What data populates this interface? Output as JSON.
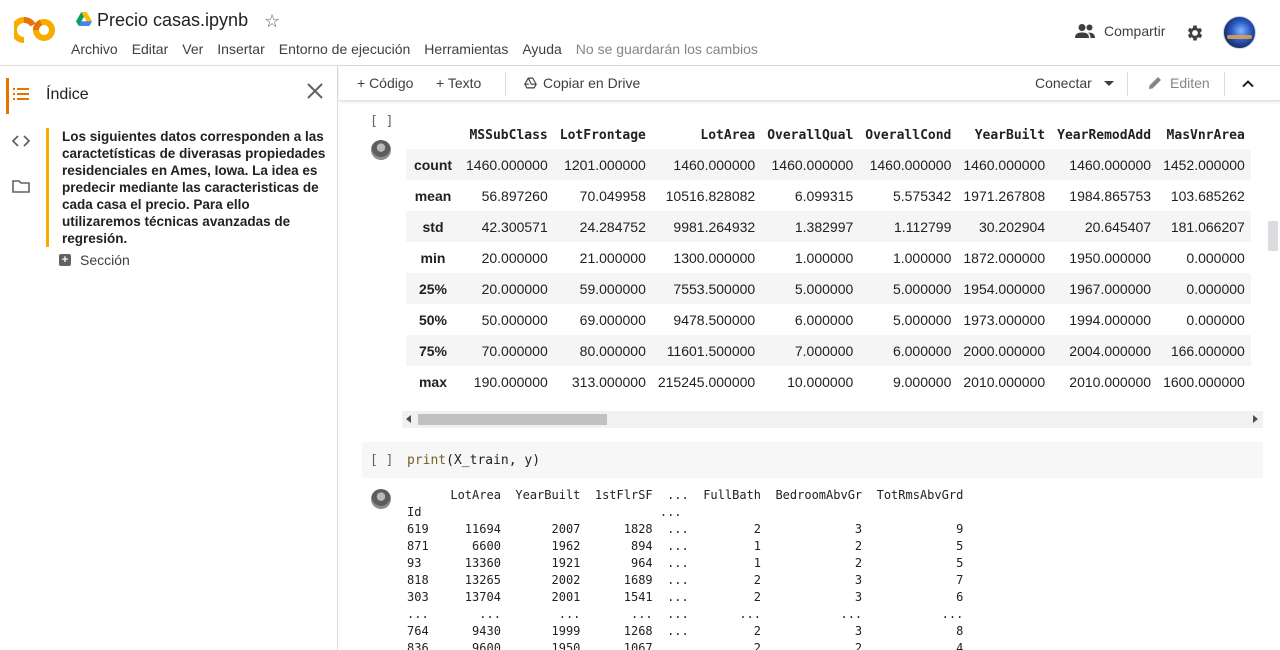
{
  "colors": {
    "accent": "#e37400",
    "logo_orange": "#f9ab00",
    "toc_border": "#f9ab00"
  },
  "header": {
    "title": "Precio casas.ipynb",
    "menu": [
      "Archivo",
      "Editar",
      "Ver",
      "Insertar",
      "Entorno de ejecución",
      "Herramientas",
      "Ayuda"
    ],
    "save_status": "No se guardarán los cambios",
    "share_label": "Compartir"
  },
  "sidebar": {
    "title": "Índice",
    "toc_entry": "Los siguientes datos corresponden a las caractetísticas de diverasas propiedades residenciales en Ames, Iowa. La idea es predecir mediante las caracteristicas de cada casa el precio. Para ello utilizaremos técnicas avanzadas de regresión.",
    "section_label": "Sección"
  },
  "toolbar": {
    "code_label": "+ Código",
    "text_label": "+ Texto",
    "copy_drive_label": "Copiar en Drive",
    "connect_label": "Conectar",
    "edit_label": "Editen"
  },
  "cells": {
    "cell1_bracket": "[ ]",
    "describe_table": {
      "columns": [
        "MSSubClass",
        "LotFrontage",
        "LotArea",
        "OverallQual",
        "OverallCond",
        "YearBuilt",
        "YearRemodAdd",
        "MasVnrArea"
      ],
      "rows": [
        {
          "label": "count",
          "values": [
            "1460.000000",
            "1201.000000",
            "1460.000000",
            "1460.000000",
            "1460.000000",
            "1460.000000",
            "1460.000000",
            "1452.000000"
          ]
        },
        {
          "label": "mean",
          "values": [
            "56.897260",
            "70.049958",
            "10516.828082",
            "6.099315",
            "5.575342",
            "1971.267808",
            "1984.865753",
            "103.685262"
          ]
        },
        {
          "label": "std",
          "values": [
            "42.300571",
            "24.284752",
            "9981.264932",
            "1.382997",
            "1.112799",
            "30.202904",
            "20.645407",
            "181.066207"
          ]
        },
        {
          "label": "min",
          "values": [
            "20.000000",
            "21.000000",
            "1300.000000",
            "1.000000",
            "1.000000",
            "1872.000000",
            "1950.000000",
            "0.000000"
          ]
        },
        {
          "label": "25%",
          "values": [
            "20.000000",
            "59.000000",
            "7553.500000",
            "5.000000",
            "5.000000",
            "1954.000000",
            "1967.000000",
            "0.000000"
          ]
        },
        {
          "label": "50%",
          "values": [
            "50.000000",
            "69.000000",
            "9478.500000",
            "6.000000",
            "5.000000",
            "1973.000000",
            "1994.000000",
            "0.000000"
          ]
        },
        {
          "label": "75%",
          "values": [
            "70.000000",
            "80.000000",
            "11601.500000",
            "7.000000",
            "6.000000",
            "2000.000000",
            "2004.000000",
            "166.000000"
          ]
        },
        {
          "label": "max",
          "values": [
            "190.000000",
            "313.000000",
            "215245.000000",
            "10.000000",
            "9.000000",
            "2010.000000",
            "2010.000000",
            "1600.000000"
          ]
        }
      ]
    },
    "cell2_bracket": "[ ]",
    "cell2_code_fn": "print",
    "cell2_code_args": "(X_train, y)",
    "print_output": "      LotArea  YearBuilt  1stFlrSF  ...  FullBath  BedroomAbvGr  TotRmsAbvGrd\nId                                 ...                                        \n619     11694       2007      1828  ...         2             3             9\n871      6600       1962       894  ...         1             2             5\n93      13360       1921       964  ...         1             2             5\n818     13265       2002      1689  ...         2             3             7\n303     13704       2001      1541  ...         2             3             6\n...       ...        ...       ...  ...       ...           ...           ...\n764      9430       1999      1268  ...         2             3             8\n836      9600       1950      1067  ...         2             2             4"
  }
}
